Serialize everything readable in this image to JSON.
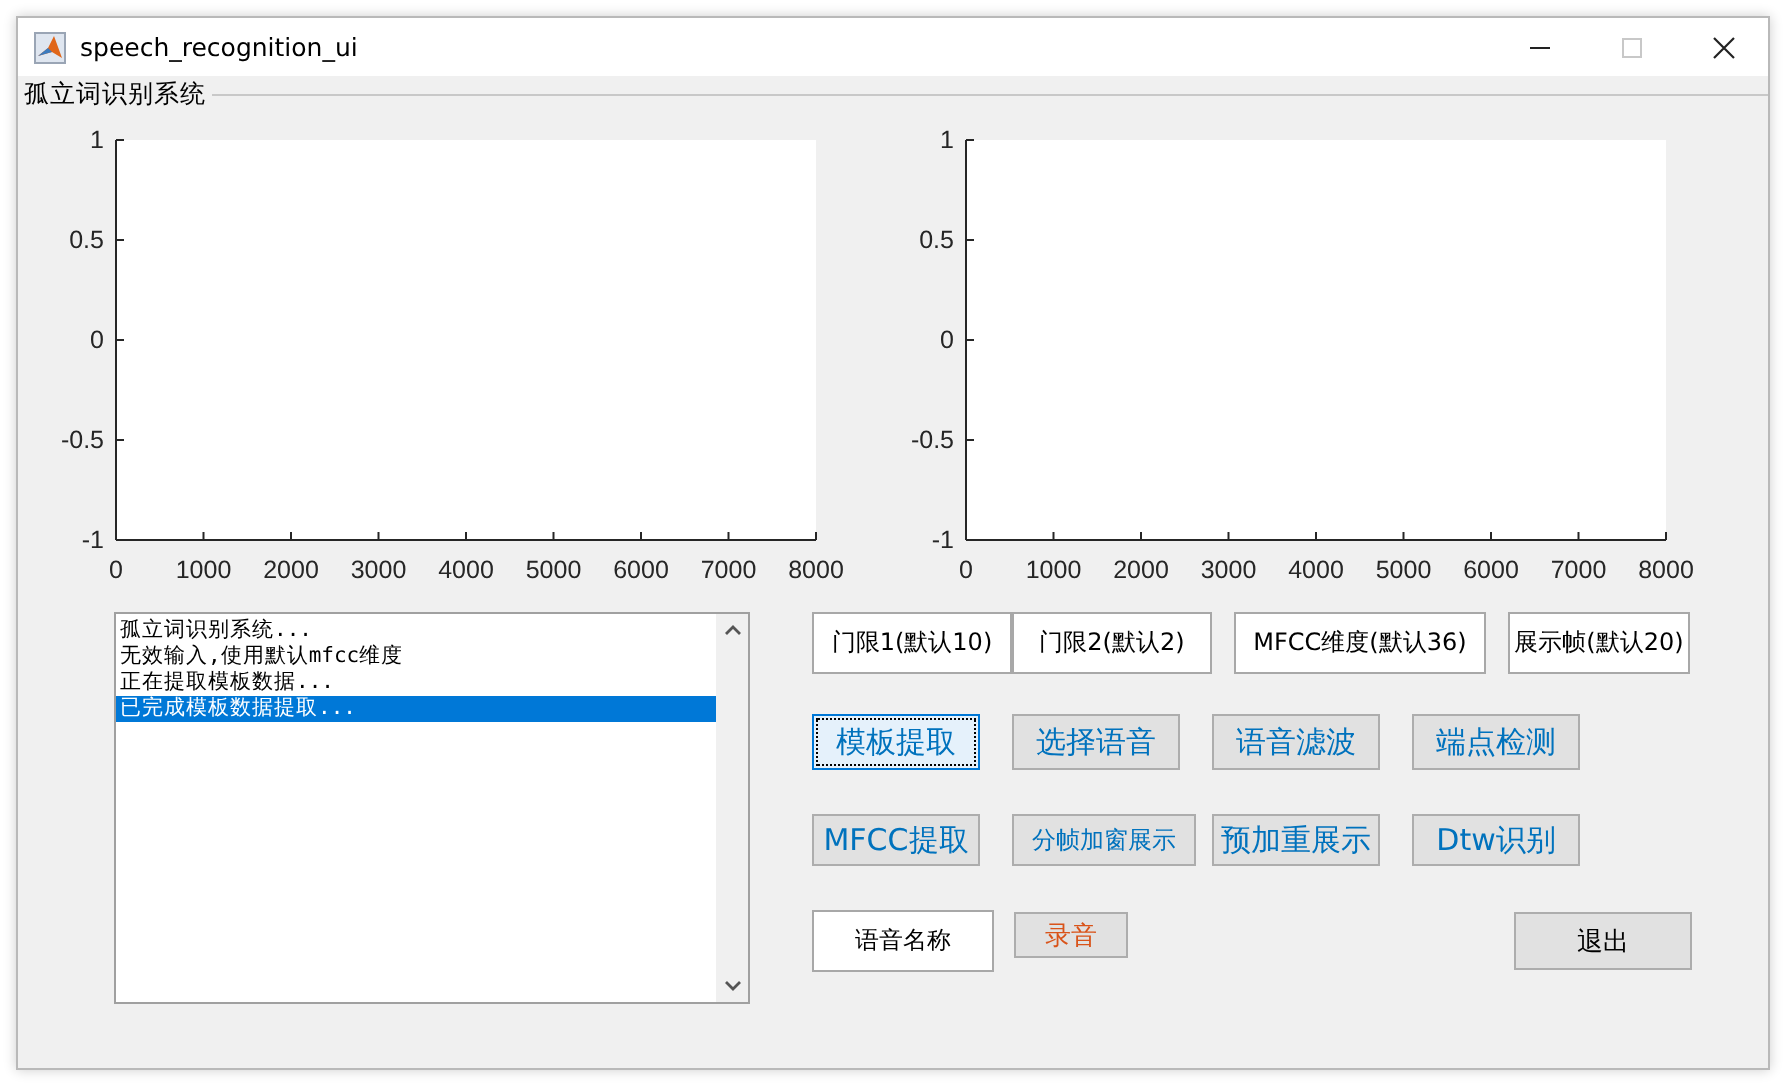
{
  "window": {
    "title": "speech_recognition_ui"
  },
  "panel": {
    "title": "孤立词识别系统"
  },
  "axes": [
    {
      "chart_data": {
        "type": "line",
        "xlim": [
          0,
          8000
        ],
        "ylim": [
          -1,
          1
        ],
        "xticks": [
          0,
          1000,
          2000,
          3000,
          4000,
          5000,
          6000,
          7000,
          8000
        ],
        "yticks": [
          -1,
          -0.5,
          0,
          0.5,
          1
        ]
      }
    },
    {
      "chart_data": {
        "type": "line",
        "xlim": [
          0,
          8000
        ],
        "ylim": [
          -1,
          1
        ],
        "xticks": [
          0,
          1000,
          2000,
          3000,
          4000,
          5000,
          6000,
          7000,
          8000
        ],
        "yticks": [
          -1,
          -0.5,
          0,
          0.5,
          1
        ]
      }
    }
  ],
  "log": {
    "lines": [
      {
        "text": "孤立词识别系统...",
        "selected": false
      },
      {
        "text": "无效输入,使用默认mfcc维度",
        "selected": false
      },
      {
        "text": "正在提取模板数据...",
        "selected": false
      },
      {
        "text": "已完成模板数据提取...",
        "selected": true
      }
    ]
  },
  "fields": [
    {
      "value": "门限1(默认10)"
    },
    {
      "value": "门限2(默认2)"
    },
    {
      "value": "MFCC维度(默认36)"
    },
    {
      "value": "展示帧(默认20)"
    }
  ],
  "button_rows": [
    [
      {
        "label": "模板提取",
        "kind": "large",
        "focused": true
      },
      {
        "label": "选择语音",
        "kind": "large",
        "focused": false
      },
      {
        "label": "语音滤波",
        "kind": "large",
        "focused": false
      },
      {
        "label": "端点检测",
        "kind": "large",
        "focused": false
      }
    ],
    [
      {
        "label": "MFCC提取",
        "kind": "large",
        "focused": false
      },
      {
        "label": "分帧加窗展示",
        "kind": "small",
        "focused": false
      },
      {
        "label": "预加重展示",
        "kind": "large",
        "focused": false
      },
      {
        "label": "Dtw识别",
        "kind": "large",
        "focused": false
      }
    ]
  ],
  "name_field": {
    "value": "语音名称"
  },
  "record_button": {
    "label": "录音"
  },
  "exit_button": {
    "label": "退出"
  }
}
